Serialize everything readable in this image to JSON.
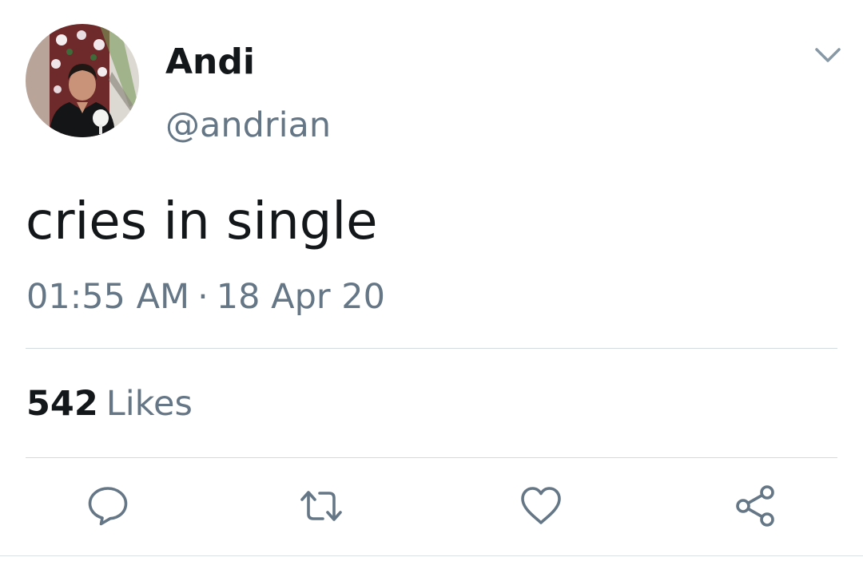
{
  "author": {
    "display_name": "Andi",
    "handle": "@andrian"
  },
  "tweet": {
    "text": "cries in single",
    "time": "01:55 AM",
    "separator": "·",
    "date": "18 Apr 20"
  },
  "stats": {
    "likes_count": "542",
    "likes_label": "Likes"
  },
  "icons": {
    "menu": "chevron-down-icon",
    "reply": "speech-bubble-icon",
    "retweet": "retweet-icon",
    "like": "heart-icon",
    "share": "share-icon"
  },
  "colors": {
    "text_primary": "#14171a",
    "text_secondary": "#657786",
    "icon": "#657786",
    "divider": "#d4dbe0",
    "background": "#ffffff"
  }
}
